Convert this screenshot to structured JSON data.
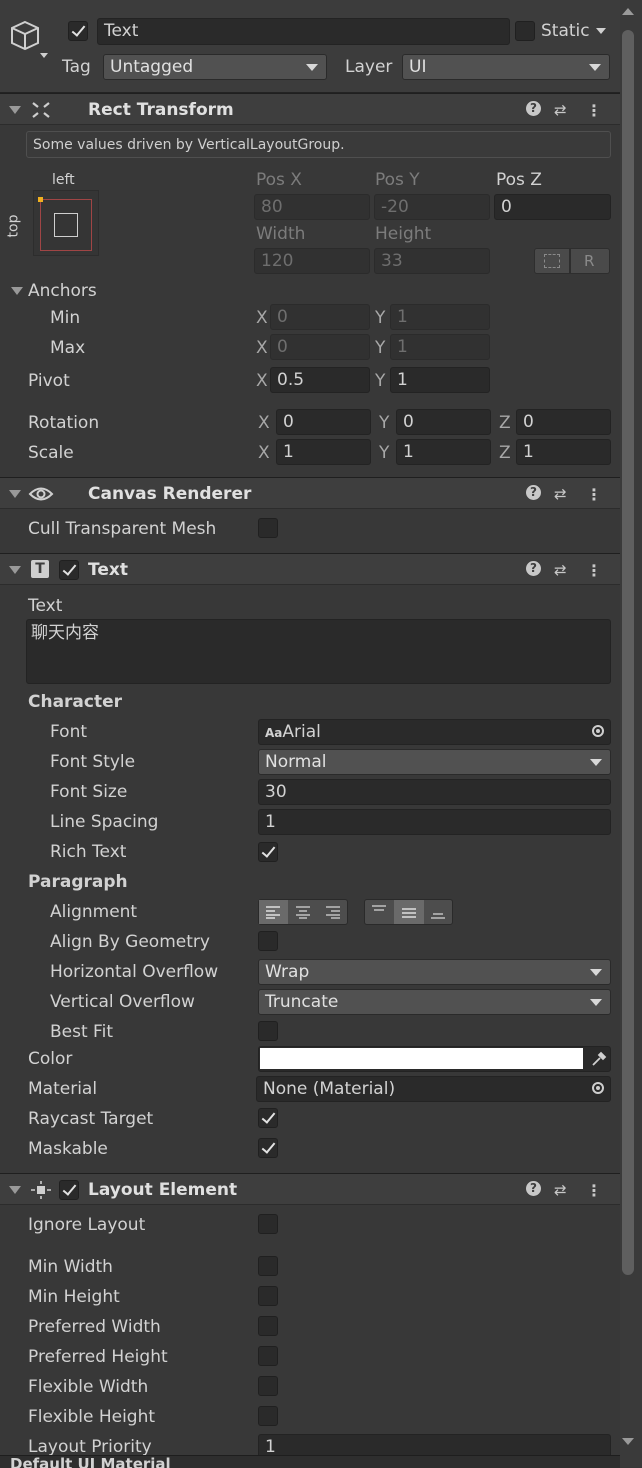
{
  "gameobject": {
    "name": "Text",
    "static_label": "Static",
    "tag_label": "Tag",
    "tag_value": "Untagged",
    "layer_label": "Layer",
    "layer_value": "UI"
  },
  "rect_transform": {
    "title": "Rect Transform",
    "driven_note": "Some values driven by VerticalLayoutGroup.",
    "anchor_h": "left",
    "anchor_v": "top",
    "pos_x_label": "Pos X",
    "pos_x": "80",
    "pos_y_label": "Pos Y",
    "pos_y": "-20",
    "pos_z_label": "Pos Z",
    "pos_z": "0",
    "width_label": "Width",
    "width": "120",
    "height_label": "Height",
    "height": "33",
    "r_button": "R",
    "anchors_label": "Anchors",
    "min_label": "Min",
    "min_x": "0",
    "min_y": "1",
    "max_label": "Max",
    "max_x": "0",
    "max_y": "1",
    "pivot_label": "Pivot",
    "pivot_x": "0.5",
    "pivot_y": "1",
    "rotation_label": "Rotation",
    "rot_x": "0",
    "rot_y": "0",
    "rot_z": "0",
    "scale_label": "Scale",
    "scale_x": "1",
    "scale_y": "1",
    "scale_z": "1",
    "x": "X",
    "y": "Y",
    "z": "Z"
  },
  "canvas_renderer": {
    "title": "Canvas Renderer",
    "cull_label": "Cull Transparent Mesh"
  },
  "text_component": {
    "title": "Text",
    "text_label": "Text",
    "text_value": "聊天内容",
    "character_label": "Character",
    "font_label": "Font",
    "font_prefix": "Aa",
    "font_value": "Arial",
    "font_style_label": "Font Style",
    "font_style_value": "Normal",
    "font_size_label": "Font Size",
    "font_size_value": "30",
    "line_spacing_label": "Line Spacing",
    "line_spacing_value": "1",
    "rich_text_label": "Rich Text",
    "paragraph_label": "Paragraph",
    "alignment_label": "Alignment",
    "align_by_geometry_label": "Align By Geometry",
    "h_overflow_label": "Horizontal Overflow",
    "h_overflow_value": "Wrap",
    "v_overflow_label": "Vertical Overflow",
    "v_overflow_value": "Truncate",
    "best_fit_label": "Best Fit",
    "color_label": "Color",
    "color_value": "#ffffff",
    "material_label": "Material",
    "material_value": "None (Material)",
    "raycast_label": "Raycast Target",
    "maskable_label": "Maskable"
  },
  "layout_element": {
    "title": "Layout Element",
    "ignore_layout_label": "Ignore Layout",
    "min_width_label": "Min Width",
    "min_height_label": "Min Height",
    "preferred_width_label": "Preferred Width",
    "preferred_height_label": "Preferred Height",
    "flexible_width_label": "Flexible Width",
    "flexible_height_label": "Flexible Height",
    "layout_priority_label": "Layout Priority",
    "layout_priority_value": "1"
  },
  "footer": {
    "text": "Default UI Material"
  }
}
